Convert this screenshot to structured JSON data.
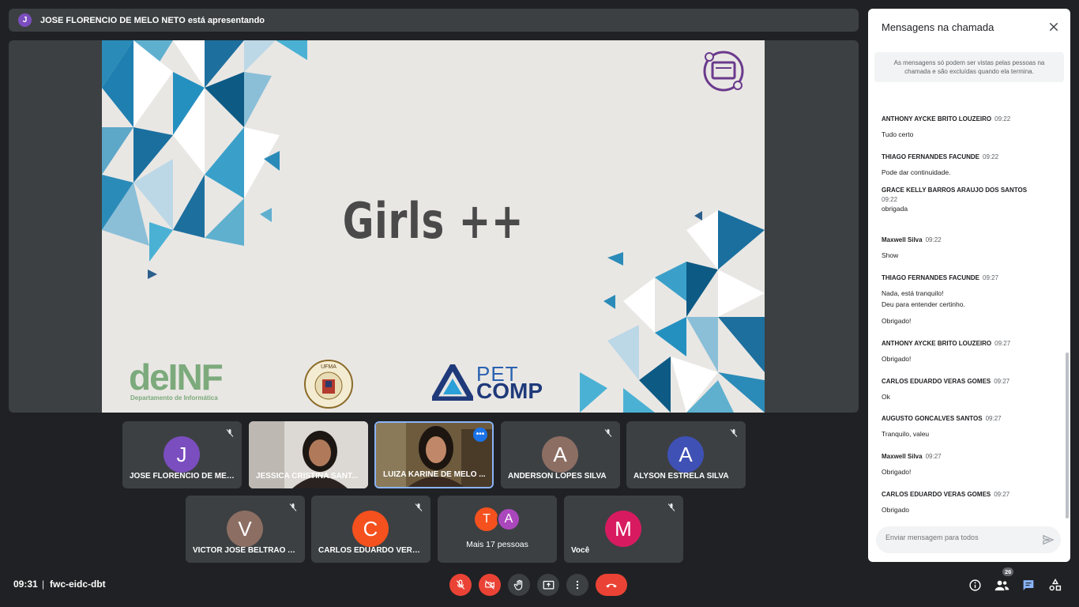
{
  "presenter": {
    "initial": "J",
    "text": "JOSE FLORENCIO DE MELO NETO está apresentando"
  },
  "slide": {
    "title": "Girls ++",
    "logo_left": {
      "main": "deINF",
      "sub": "Departamento de Informática"
    },
    "logo_center": {
      "text": "UFMA"
    },
    "logo_right": {
      "top": "PET",
      "bottom": "COMP"
    }
  },
  "tiles": [
    {
      "name": "JOSE FLORENCIO DE MEL...",
      "initial": "J",
      "color": "#7b4ebf"
    },
    {
      "name": "JESSICA CRISTINA SANT...",
      "initial": "",
      "color": ""
    },
    {
      "name": "LUIZA KARINE DE MELO ...",
      "initial": "",
      "color": ""
    },
    {
      "name": "ANDERSON LOPES SILVA",
      "initial": "A",
      "color": "#8d6e63"
    },
    {
      "name": "ALYSON ESTRELA SILVA",
      "initial": "A",
      "color": "#3f51b5"
    },
    {
      "name": "VICTOR JOSE BELTRAO AL...",
      "initial": "V",
      "color": "#8d6e63"
    },
    {
      "name": "CARLOS EDUARDO VERAS...",
      "initial": "C",
      "color": "#f4511e"
    },
    {
      "name": "Mais 17 pessoas",
      "initials": [
        "T",
        "A"
      ],
      "colors": [
        "#f4511e",
        "#ab47bc"
      ]
    },
    {
      "name": "Você",
      "initial": "M",
      "color": "#d81b60"
    }
  ],
  "status": {
    "time": "09:31",
    "separator": "|",
    "meeting_code": "fwc-eidc-dbt"
  },
  "people_count": "26",
  "chat": {
    "title": "Mensagens na chamada",
    "note": "As mensagens só podem ser vistas pelas pessoas na chamada e são excluídas quando ela termina.",
    "messages": [
      {
        "sender": "ANTHONY AYCKE BRITO LOUZEIRO",
        "time": "09:22",
        "body": "Tudo certo"
      },
      {
        "sender": "THIAGO FERNANDES FACUNDE",
        "time": "09:22",
        "body": "Pode dar continuidade."
      },
      {
        "sender": "GRACE KELLY BARROS ARAUJO DOS SANTOS",
        "time": "09:22",
        "body": "obrigada"
      },
      {
        "sender": "Maxwell Silva",
        "time": "09:22",
        "body": "Show"
      },
      {
        "sender": "THIAGO FERNANDES FACUNDE",
        "time": "09:27",
        "body": "Nada, está tranquilo!",
        "body2": "Deu para entender certinho.",
        "body3": "Obrigado!"
      },
      {
        "sender": "ANTHONY AYCKE BRITO LOUZEIRO",
        "time": "09:27",
        "body": "Obrigado!"
      },
      {
        "sender": "CARLOS EDUARDO VERAS GOMES",
        "time": "09:27",
        "body": "Ok"
      },
      {
        "sender": "AUGUSTO GONCALVES SANTOS",
        "time": "09:27",
        "body": "Tranquilo, valeu"
      },
      {
        "sender": "Maxwell Silva",
        "time": "09:27",
        "body": "Obrigado!"
      },
      {
        "sender": "CARLOS EDUARDO VERAS GOMES",
        "time": "09:27",
        "body": "Obrigado"
      }
    ],
    "input_placeholder": "Enviar mensagem para todos"
  },
  "colors": {
    "accent": "#1a73e8",
    "danger": "#ea4335",
    "background": "#202124",
    "tile": "#3c4043"
  }
}
